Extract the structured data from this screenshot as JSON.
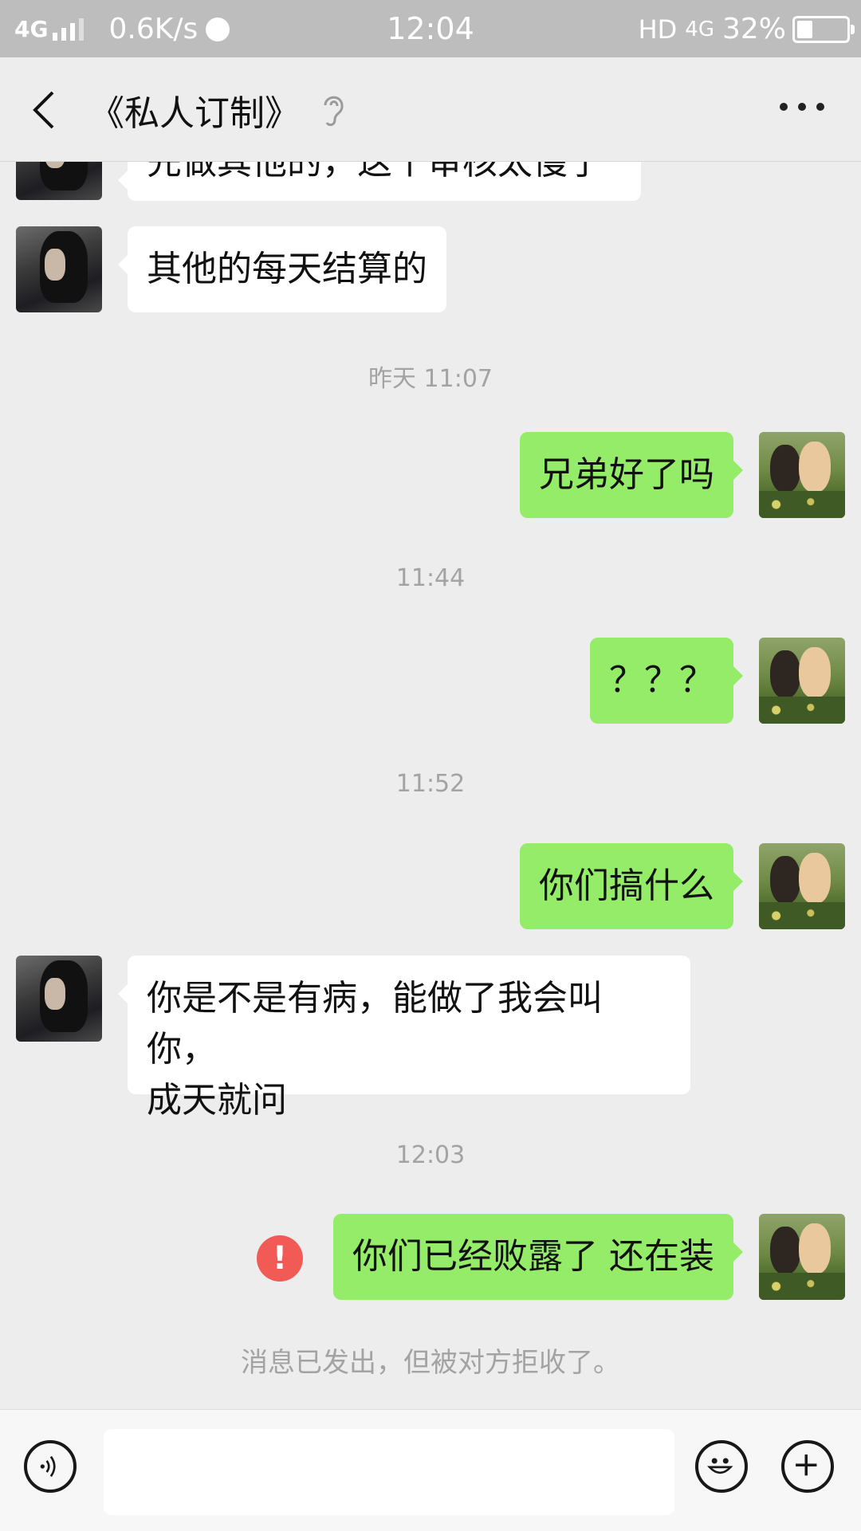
{
  "status_bar": {
    "network": "4G",
    "speed": "0.6K/s",
    "time": "12:04",
    "hd": "HD",
    "net_type": "4G",
    "battery_percent": "32%",
    "battery_level": 0.32
  },
  "header": {
    "title": "《私人订制》",
    "back_icon": "back-chevron-icon",
    "ear_icon": "ear-icon",
    "more_icon": "more-icon"
  },
  "messages": [
    {
      "side": "left",
      "text": "先做其他的，这个审核太慢了"
    },
    {
      "side": "left",
      "text": "其他的每天结算的"
    },
    {
      "type": "timestamp",
      "text": "昨天 11:07"
    },
    {
      "side": "right",
      "text": "兄弟好了吗"
    },
    {
      "type": "timestamp",
      "text": "11:44"
    },
    {
      "side": "right",
      "text": "？？？"
    },
    {
      "type": "timestamp",
      "text": "11:52"
    },
    {
      "side": "right",
      "text": "你们搞什么"
    },
    {
      "side": "left",
      "line1": "你是不是有病，能做了我会叫你，",
      "line2": "成天就问"
    },
    {
      "type": "timestamp",
      "text": "12:03"
    },
    {
      "side": "right",
      "text": "你们已经败露了 还在装",
      "status": "failed",
      "status_icon": "!"
    },
    {
      "type": "system",
      "text": "消息已发出，但被对方拒收了。"
    }
  ],
  "input_bar": {
    "voice_icon": "voice-icon",
    "emoji_icon": "emoji-icon",
    "plus_icon": "plus-icon",
    "input_value": ""
  },
  "colors": {
    "background": "#ededed",
    "my_bubble": "#95ec69",
    "their_bubble": "#ffffff",
    "error": "#f25b55",
    "status_bar": "#bdbdbd"
  }
}
